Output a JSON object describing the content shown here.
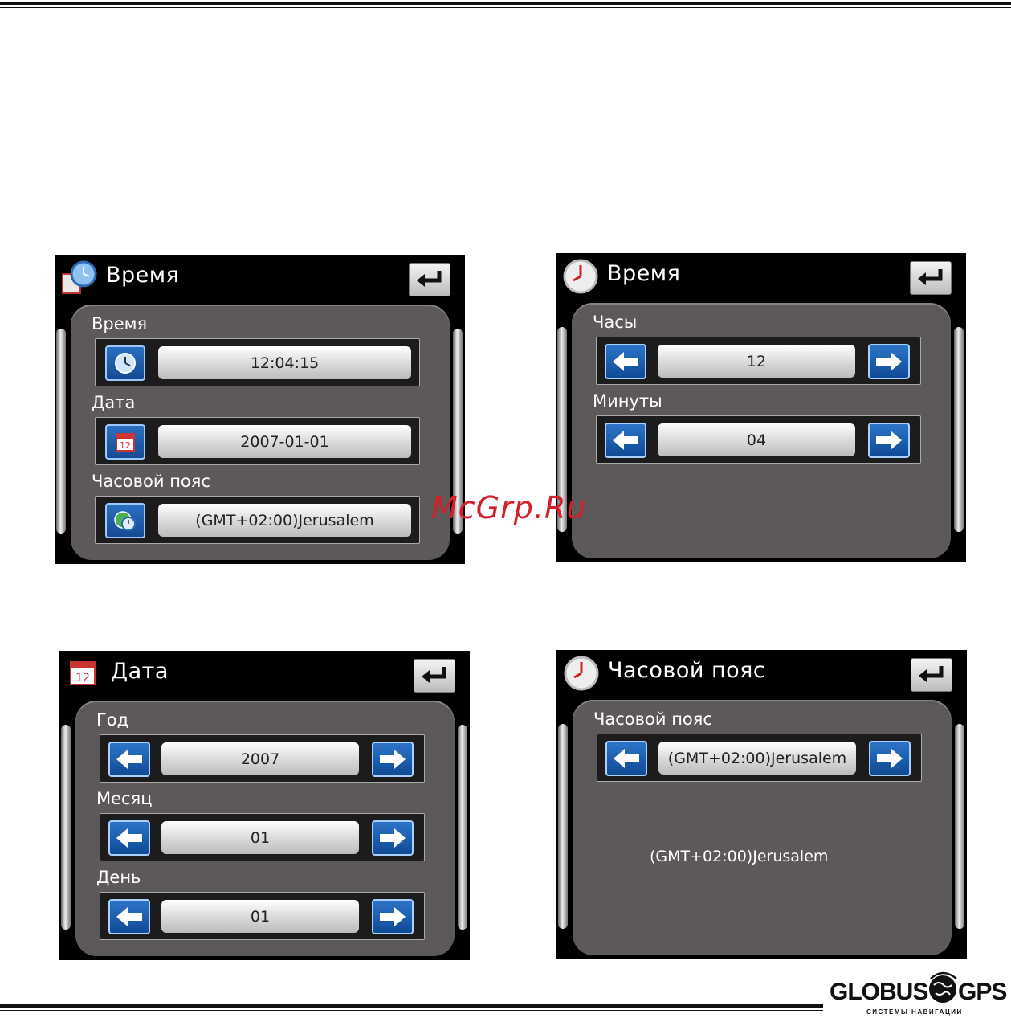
{
  "watermark": "McGrp.Ru",
  "screens": {
    "time_main": {
      "title": "Время",
      "rows": [
        {
          "label": "Время",
          "value": "12:04:15"
        },
        {
          "label": "Дата",
          "value": "2007-01-01"
        },
        {
          "label": "Часовой пояс",
          "value": "(GMT+02:00)Jerusalem"
        }
      ]
    },
    "time_edit": {
      "title": "Время",
      "rows": [
        {
          "label": "Часы",
          "value": "12"
        },
        {
          "label": "Минуты",
          "value": "04"
        }
      ]
    },
    "date_edit": {
      "title": "Дата",
      "rows": [
        {
          "label": "Год",
          "value": "2007"
        },
        {
          "label": "Месяц",
          "value": "01"
        },
        {
          "label": "День",
          "value": "01"
        }
      ]
    },
    "timezone_edit": {
      "title": "Часовой пояс",
      "rows": [
        {
          "label": "Часовой пояс",
          "value": "(GMT+02:00)Jerusalem"
        }
      ],
      "current": "(GMT+02:00)Jerusalem"
    }
  },
  "logo": {
    "left": "GLOBUS",
    "right": "GPS",
    "subtitle": "СИСТЕМЫ НАВИГАЦИИ"
  },
  "colors": {
    "panel": "#5d5959",
    "accent_blue": "#1f5fb0",
    "watermark_red": "#d4202a"
  },
  "icons": [
    "clock-icon",
    "calendar-icon",
    "globe-clock-icon",
    "return-arrow-icon",
    "left-arrow-icon",
    "right-arrow-icon"
  ]
}
